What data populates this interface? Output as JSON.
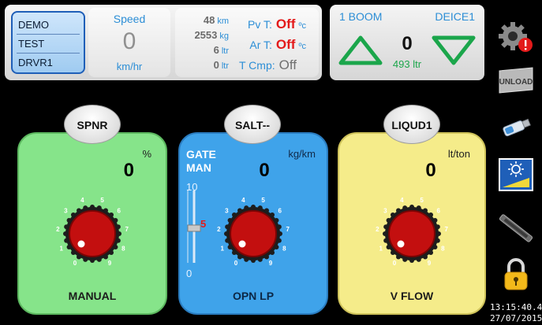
{
  "vehicle": {
    "rows": [
      "DEMO",
      "TEST",
      "DRVR1"
    ]
  },
  "speed": {
    "label": "Speed",
    "value": "0",
    "unit": "km/hr"
  },
  "stats": [
    {
      "value": "48",
      "unit": "km"
    },
    {
      "value": "2553",
      "unit": "kg"
    },
    {
      "value": "6",
      "unit": "ltr"
    },
    {
      "value": "0",
      "unit": "ltr"
    }
  ],
  "temps": {
    "pv_label": "Pv T:",
    "pv_value": "Off",
    "pv_unit": "ºc",
    "ar_label": "Ar T:",
    "ar_value": "Off",
    "ar_unit": "ºc",
    "cmp_label": "T Cmp:",
    "cmp_value": "Off"
  },
  "boom": {
    "label": "1 BOOM",
    "deice": "DEICE1",
    "value": "0",
    "liters": "493 ltr"
  },
  "cards": {
    "spnr": {
      "button": "SPNR",
      "unit": "%",
      "value": "0",
      "caption": "MANUAL"
    },
    "salt": {
      "button": "SALT--",
      "unit": "kg/km",
      "value": "0",
      "gate": "GATE",
      "mode": "MAN",
      "scale_top": "10",
      "scale_bottom": "0",
      "scale_mark": "5",
      "caption": "OPN LP"
    },
    "liqud": {
      "button": "LIQUD1",
      "unit": "lt/ton",
      "value": "0",
      "caption": "V FLOW"
    }
  },
  "knob_ticks": [
    "0",
    "1",
    "2",
    "3",
    "4",
    "5",
    "6",
    "7",
    "8",
    "9"
  ],
  "rail": {
    "unload_label": "UNLOAD"
  },
  "clock": {
    "time": "13:15:40.4",
    "date": "27/07/2015"
  },
  "colors": {
    "off_red": "#e31a1a",
    "accent_blue": "#2c8ed6",
    "arrow_green": "#1ba64b"
  }
}
